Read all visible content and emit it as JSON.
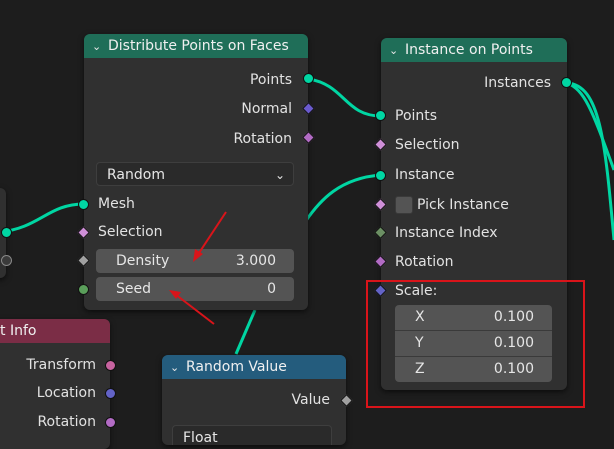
{
  "colors": {
    "geometry_header": "#1f6e58",
    "function_header": "#245c7d",
    "input_header": "#7b2d46",
    "wire_geometry": "#00d6a3",
    "annotation_red": "#d9141a"
  },
  "distribute": {
    "title": "Distribute Points on Faces",
    "outputs": [
      "Points",
      "Normal",
      "Rotation"
    ],
    "mode": "Random",
    "inputs": {
      "mesh": "Mesh",
      "selection": "Selection",
      "density_label": "Density",
      "density_value": "3.000",
      "seed_label": "Seed",
      "seed_value": "0"
    }
  },
  "instance": {
    "title": "Instance on Points",
    "output": "Instances",
    "points": "Points",
    "selection": "Selection",
    "instance": "Instance",
    "pick_instance": "Pick Instance",
    "instance_index": "Instance Index",
    "rotation": "Rotation",
    "scale": "Scale:",
    "scale_x_label": "X",
    "scale_x": "0.100",
    "scale_y_label": "Y",
    "scale_y": "0.100",
    "scale_z_label": "Z",
    "scale_z": "0.100"
  },
  "object_info": {
    "title_partial": "t Info",
    "outputs": [
      "Transform",
      "Location",
      "Rotation"
    ]
  },
  "random_value": {
    "title": "Random Value",
    "output": "Value",
    "type_partial": "Float"
  }
}
